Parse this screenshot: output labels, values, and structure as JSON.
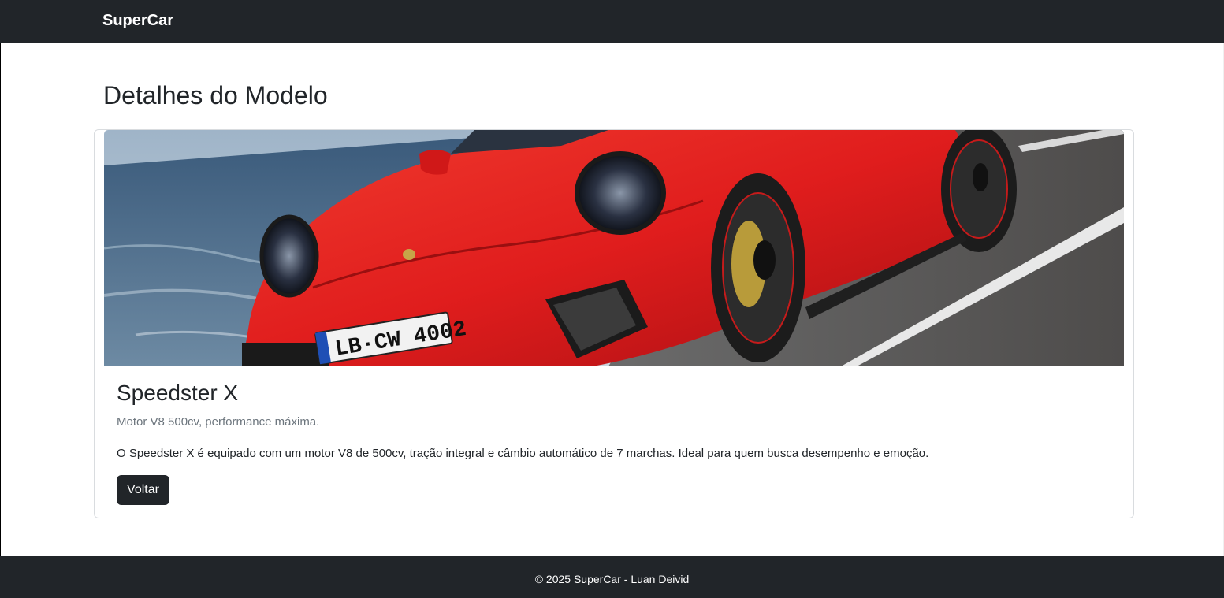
{
  "navbar": {
    "brand": "SuperCar"
  },
  "page": {
    "title": "Detalhes do Modelo"
  },
  "car": {
    "image_alt": "Red sports car driving along a coastal road",
    "plate_text": "LB·CW 4002",
    "name": "Speedster X",
    "subtitle": "Motor V8 500cv, performance máxima.",
    "description": "O Speedster X é equipado com um motor V8 de 500cv, tração integral e câmbio automático de 7 marchas. Ideal para quem busca desempenho e emoção.",
    "back_label": "Voltar"
  },
  "footer": {
    "text": "© 2025 SuperCar - Luan Deivid"
  },
  "colors": {
    "navbar_bg": "#212529",
    "car_red": "#e01d1d",
    "button_bg": "#212529",
    "muted_text": "#6c757d"
  }
}
